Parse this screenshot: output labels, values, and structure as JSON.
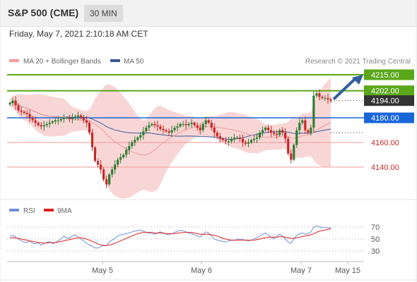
{
  "header": {
    "title": "S&P 500 (CME)",
    "timeframe": "30 MIN"
  },
  "timestamp": "Friday, May 7, 2021 2:10:18 AM CET",
  "copyright": "Research © 2021 Trading Central",
  "colors": {
    "candle_up": "#2e7d32",
    "candle_down": "#c62828",
    "bollinger_fill": "#f8cfcf",
    "ma20": "#ef9a9a",
    "ma50": "#3b5998",
    "green_level": "#5aa71a",
    "blue_level": "#1a66d9",
    "red_level": "#f29a9a",
    "arrow": "#2f5f9e",
    "rsi_line": "#6f8fd8",
    "rsi_ma": "#e02020",
    "current_price_box": "#333333"
  },
  "chart_data": [
    {
      "type": "candlestick",
      "legend": [
        {
          "name": "MA 20 + Bollinger Bands",
          "color": "#f59b9b"
        },
        {
          "name": "MA 50",
          "color": "#3b5998"
        }
      ],
      "ylim": [
        4115,
        4230
      ],
      "x_ticks": [
        "May 5",
        "May 6",
        "May 7",
        "May 15"
      ],
      "current_price": "4194.00",
      "levels": [
        {
          "label": "4215.00",
          "value": 4215,
          "kind": "resistance"
        },
        {
          "label": "4202.00",
          "value": 4202,
          "kind": "resistance"
        },
        {
          "label": "4180.00",
          "value": 4180,
          "kind": "pivot"
        },
        {
          "label": "4160.00",
          "value": 4160,
          "kind": "support"
        },
        {
          "label": "4140.00",
          "value": 4140,
          "kind": "support"
        }
      ],
      "close": [
        4192,
        4194,
        4190,
        4186,
        4185,
        4184,
        4183,
        4180,
        4178,
        4176,
        4174,
        4173,
        4174,
        4175,
        4176,
        4177,
        4178,
        4178,
        4179,
        4180,
        4180,
        4179,
        4180,
        4181,
        4182,
        4180,
        4178,
        4176,
        4168,
        4156,
        4145,
        4142,
        4138,
        4130,
        4126,
        4134,
        4138,
        4142,
        4146,
        4148,
        4150,
        4154,
        4157,
        4160,
        4162,
        4164,
        4166,
        4169,
        4172,
        4174,
        4175,
        4174,
        4173,
        4171,
        4170,
        4169,
        4168,
        4170,
        4172,
        4173,
        4175,
        4175,
        4174,
        4175,
        4176,
        4174,
        4172,
        4170,
        4175,
        4178,
        4176,
        4172,
        4168,
        4165,
        4163,
        4162,
        4161,
        4161,
        4163,
        4164,
        4164,
        4163,
        4160,
        4159,
        4160,
        4162,
        4163,
        4164,
        4168,
        4170,
        4172,
        4170,
        4168,
        4167,
        4166,
        4170,
        4168,
        4163,
        4151,
        4146,
        4158,
        4170,
        4176,
        4178,
        4170,
        4168,
        4172,
        4198,
        4200,
        4197,
        4196,
        4196,
        4195,
        4194
      ],
      "rsi": {
        "legend": [
          "RSI",
          "9MA"
        ],
        "ylim": [
          20,
          80
        ],
        "y_ticks": [
          "70",
          "50",
          "30"
        ],
        "rsi_line": [
          55,
          56,
          53,
          50,
          47,
          45,
          44,
          47,
          43,
          42,
          44,
          40,
          42,
          44,
          46,
          42,
          44,
          47,
          50,
          55,
          52,
          51,
          55,
          57,
          53,
          50,
          47,
          43,
          40,
          38,
          35,
          35,
          37,
          40,
          39,
          45,
          48,
          51,
          55,
          57,
          58,
          59,
          60,
          62,
          63,
          64,
          65,
          63,
          61,
          60,
          59,
          58,
          60,
          62,
          60,
          58,
          57,
          59,
          61,
          63,
          64,
          64,
          62,
          60,
          59,
          57,
          55,
          53,
          58,
          62,
          60,
          55,
          50,
          48,
          47,
          46,
          45,
          47,
          48,
          48,
          49,
          50,
          49,
          48,
          47,
          48,
          50,
          52,
          55,
          58,
          60,
          57,
          53,
          50,
          55,
          58,
          55,
          50,
          45,
          43,
          50,
          56,
          59,
          60,
          58,
          59,
          62,
          70,
          72,
          70,
          69,
          69,
          69,
          68
        ],
        "ma_line": [
          52,
          52,
          52,
          51,
          50,
          49,
          48,
          47,
          46,
          45,
          44,
          44,
          43,
          43,
          44,
          44,
          44,
          45,
          46,
          47,
          48,
          49,
          50,
          51,
          52,
          52,
          51,
          50,
          48,
          46,
          44,
          42,
          40,
          39,
          39,
          40,
          41,
          43,
          45,
          47,
          49,
          51,
          53,
          55,
          57,
          59,
          60,
          61,
          61,
          61,
          61,
          60,
          60,
          60,
          60,
          59,
          59,
          59,
          59,
          60,
          60,
          61,
          61,
          61,
          61,
          60,
          59,
          58,
          58,
          58,
          58,
          57,
          56,
          55,
          53,
          51,
          50,
          49,
          48,
          48,
          48,
          48,
          48,
          48,
          48,
          48,
          48,
          49,
          50,
          51,
          52,
          53,
          53,
          53,
          53,
          54,
          54,
          53,
          52,
          51,
          51,
          52,
          53,
          54,
          55,
          56,
          57,
          59,
          61,
          63,
          64,
          65,
          66,
          67
        ]
      }
    }
  ]
}
